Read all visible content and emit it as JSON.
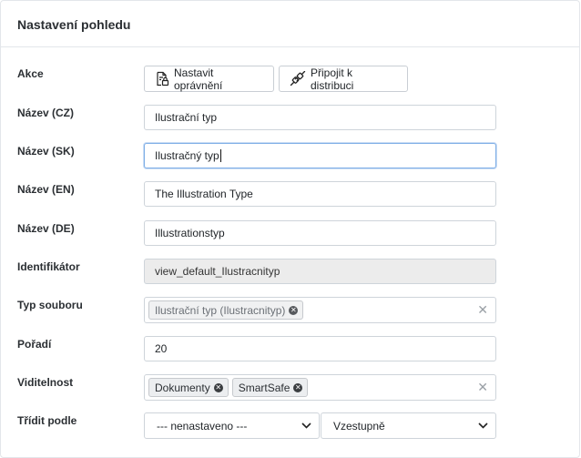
{
  "panel": {
    "title": "Nastavení pohledu"
  },
  "labels": {
    "akce": "Akce",
    "nazev_cz": "Název (CZ)",
    "nazev_sk": "Název (SK)",
    "nazev_en": "Název (EN)",
    "nazev_de": "Název (DE)",
    "identifikator": "Identifikátor",
    "typ_souboru": "Typ souboru",
    "poradi": "Pořadí",
    "viditelnost": "Viditelnost",
    "tridit_podle": "Třídit podle"
  },
  "actions": {
    "permissions_label": "Nastavit oprávnění",
    "permissions_icon": "document-lock-icon",
    "distribution_label": "Připojit k distribuci",
    "distribution_icon": "plug-connect-icon"
  },
  "fields": {
    "nazev_cz": "Ilustrační typ",
    "nazev_sk": "Ilustračný typ",
    "nazev_en": "The Illustration Type",
    "nazev_de": "Illustrationstyp",
    "identifikator": "view_default_Ilustracnityp",
    "poradi": "20"
  },
  "typ_souboru": {
    "chips": [
      "Ilustrační typ (Ilustracnityp)"
    ]
  },
  "viditelnost": {
    "chips": [
      "Dokumenty",
      "SmartSafe"
    ]
  },
  "sort": {
    "field": "--- nenastaveno ---",
    "direction": "Vzestupně"
  },
  "colors": {
    "focus_border": "#7eaee6",
    "disabled_bg": "#ececec",
    "chip_bg": "#eceef0"
  }
}
